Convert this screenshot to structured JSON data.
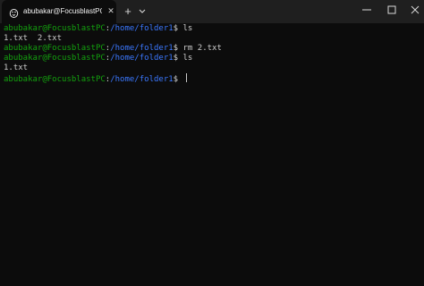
{
  "window": {
    "tab_title": "abubakar@FocusblastPC: /hor",
    "tab_close": "✕",
    "new_tab": "+",
    "icons": {
      "tab": "terminal-penguin-icon",
      "dropdown": "chevron-down-icon",
      "minimize": "minimize-icon",
      "maximize": "maximize-icon",
      "close": "close-icon"
    }
  },
  "terminal": {
    "lines": [
      {
        "user": "abubakar@FocusblastPC",
        "sep": ":",
        "path": "/home/folder1",
        "prompt": "$ ",
        "command": "ls"
      },
      {
        "output": "1.txt  2.txt"
      },
      {
        "user": "abubakar@FocusblastPC",
        "sep": ":",
        "path": "/home/folder1",
        "prompt": "$ ",
        "command": "rm 2.txt"
      },
      {
        "user": "abubakar@FocusblastPC",
        "sep": ":",
        "path": "/home/folder1",
        "prompt": "$ ",
        "command": "ls"
      },
      {
        "output": "1.txt"
      },
      {
        "user": "abubakar@FocusblastPC",
        "sep": ":",
        "path": "/home/folder1",
        "prompt": "$ ",
        "command": ""
      }
    ],
    "colors": {
      "background": "#0c0c0c",
      "user": "#13a10e",
      "path": "#3b78ff",
      "text": "#cccccc"
    }
  }
}
